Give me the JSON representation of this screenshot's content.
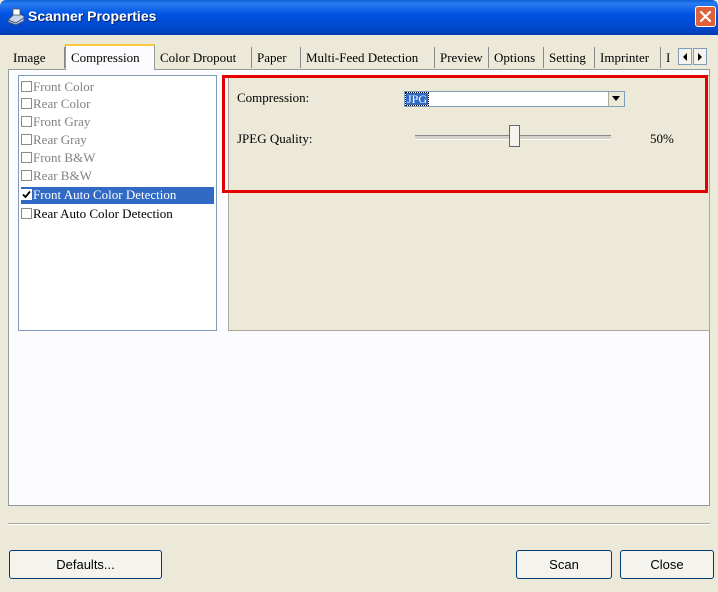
{
  "window": {
    "title": "Scanner Properties"
  },
  "tabs": [
    "Image",
    "Compression",
    "Color Dropout",
    "Paper",
    "Multi-Feed Detection",
    "Preview",
    "Options",
    "Setting",
    "Imprinter",
    "I"
  ],
  "active_tab": "Compression",
  "image_types": [
    {
      "label": "Front Color",
      "checked": false,
      "enabled": false
    },
    {
      "label": "Rear Color",
      "checked": false,
      "enabled": false
    },
    {
      "label": "Front Gray",
      "checked": false,
      "enabled": false
    },
    {
      "label": "Rear Gray",
      "checked": false,
      "enabled": false
    },
    {
      "label": "Front B&W",
      "checked": false,
      "enabled": false
    },
    {
      "label": "Rear B&W",
      "checked": false,
      "enabled": false
    },
    {
      "label": "Front Auto Color Detection",
      "checked": true,
      "enabled": true,
      "selected": true
    },
    {
      "label": "Rear Auto Color Detection",
      "checked": false,
      "enabled": true
    }
  ],
  "compression": {
    "label": "Compression:",
    "value": "JPG",
    "quality_label": "JPEG Quality:",
    "quality_value": "50%",
    "quality_fraction": 0.5
  },
  "buttons": {
    "defaults": "Defaults...",
    "scan": "Scan",
    "close": "Close"
  },
  "colors": {
    "title_bar": "#0054e3",
    "highlight_box": "#e30000",
    "selection": "#316ac5"
  }
}
